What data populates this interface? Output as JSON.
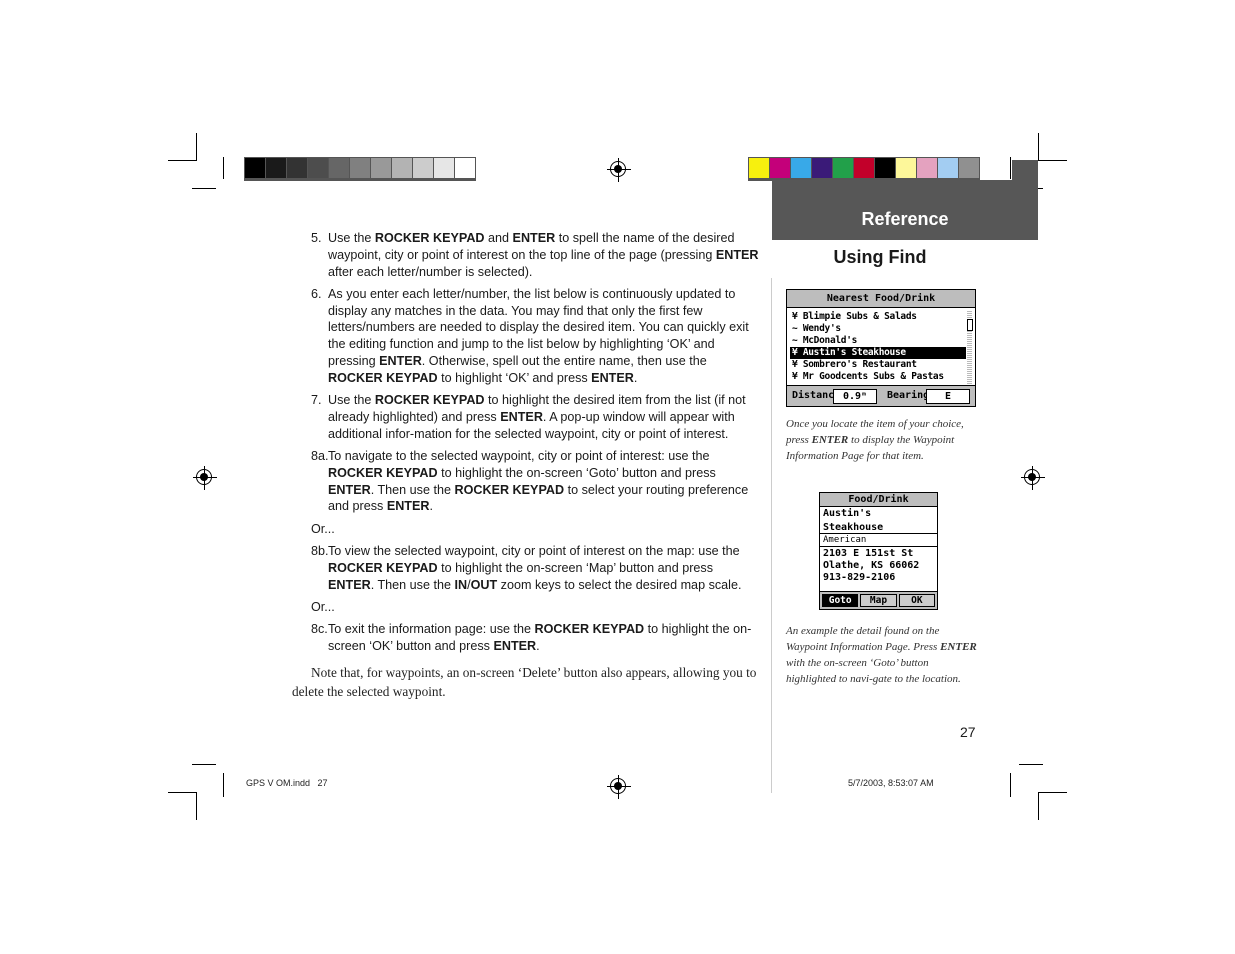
{
  "header": {
    "section": "Reference",
    "subsection": "Using Find",
    "gray_swatches": [
      "#000000",
      "#1a1a1a",
      "#333333",
      "#4d4d4d",
      "#666666",
      "#808080",
      "#999999",
      "#b3b3b3",
      "#cccccc",
      "#e6e6e6",
      "#ffffff"
    ],
    "color_swatches": [
      "#f7f00e",
      "#c4007a",
      "#38a9e8",
      "#3a1a78",
      "#22a04a",
      "#c2002a",
      "#000000",
      "#fdf79a",
      "#e4a2bf",
      "#a3cdf2",
      "#909090"
    ]
  },
  "steps": [
    {
      "num": "5.",
      "html": "Use the <b>ROCKER KEYPAD</b> and <b>ENTER</b> to spell the name of the desired waypoint, city or point of interest on the top line of the page (pressing <b>ENTER</b> after each letter/number is selected)."
    },
    {
      "num": "6.",
      "html": "As you enter each letter/number, the list below is continuously updated to display any matches in the data. You may find that only the first few letters/numbers are needed to display the desired item. You can quickly exit the editing function and jump to the list below by highlighting ‘OK’ and pressing <b>ENTER</b>. Otherwise, spell out the entire name, then use the <b>ROCKER KEYPAD</b> to highlight ‘OK’ and press <b>ENTER</b>."
    },
    {
      "num": "7.",
      "html": "Use the <b>ROCKER KEYPAD</b> to highlight the desired item from the list (if not already highlighted) and press <b>ENTER</b>. A pop-up window will appear with additional infor-mation for the selected waypoint, city or point of interest."
    },
    {
      "num": "8a.",
      "html": "To navigate to the selected waypoint, city or point of interest: use the <b>ROCKER KEYPAD</b> to highlight the on-screen ‘Goto’ button and press <b>ENTER</b>. Then use the <b>ROCKER KEYPAD</b> to select your routing preference and press <b>ENTER</b>."
    },
    {
      "or": "Or..."
    },
    {
      "num": "8b.",
      "html": "To view the selected waypoint, city or point of interest on the map: use the <b>ROCKER KEYPAD</b> to highlight the on-screen ‘Map’ button and press <b>ENTER</b>. Then use the <b>IN</b>/<b>OUT</b> zoom keys to select the desired map scale."
    },
    {
      "or": "Or..."
    },
    {
      "num": "8c.",
      "html": "To exit the information page: use the <b>ROCKER KEYPAD</b> to highlight the on-screen ‘OK’ button and press <b>ENTER</b>."
    }
  ],
  "note": "Note that, for waypoints, an on-screen ‘Delete’ button also appears, allowing you to delete the selected waypoint.",
  "screen1": {
    "title": "Nearest Food/Drink",
    "items": [
      {
        "icon": "fork-knife-icon",
        "glyph": "¥",
        "label": "Blimpie Subs & Salads",
        "selected": false
      },
      {
        "icon": "fast-food-icon",
        "glyph": "~",
        "label": "Wendy's",
        "selected": false
      },
      {
        "icon": "fast-food-icon",
        "glyph": "~",
        "label": "McDonald's",
        "selected": false
      },
      {
        "icon": "fork-knife-icon",
        "glyph": "¥",
        "label": "Austin's Steakhouse",
        "selected": true
      },
      {
        "icon": "fork-knife-icon",
        "glyph": "¥",
        "label": "Sombrero's Restaurant",
        "selected": false
      },
      {
        "icon": "fork-knife-icon",
        "glyph": "¥",
        "label": "Mr Goodcents Subs & Pastas",
        "selected": false
      }
    ],
    "distance_label": "Distance",
    "distance_value": "0.9ᵐ",
    "bearing_label": "Bearing",
    "bearing_value": "E"
  },
  "caption1": "Once you locate the item of your choice, press <b>ENTER</b> to display the Waypoint Information Page for that item.",
  "screen2": {
    "title": "Food/Drink",
    "name": "Austin's Steakhouse",
    "category": "American",
    "address_lines": [
      "2103 E 151st St",
      "Olathe, KS 66062",
      "913-829-2106"
    ],
    "buttons": [
      {
        "label": "Goto",
        "selected": true
      },
      {
        "label": "Map",
        "selected": false
      },
      {
        "label": "OK",
        "selected": false
      }
    ]
  },
  "caption2": "An example the detail found on the Waypoint Information Page. Press <b>ENTER</b> with the on-screen ‘Goto’ button highlighted to navi-gate to the location.",
  "page_number": "27",
  "slug_left": "GPS V OM.indd   27",
  "slug_right": "5/7/2003, 8:53:07 AM"
}
